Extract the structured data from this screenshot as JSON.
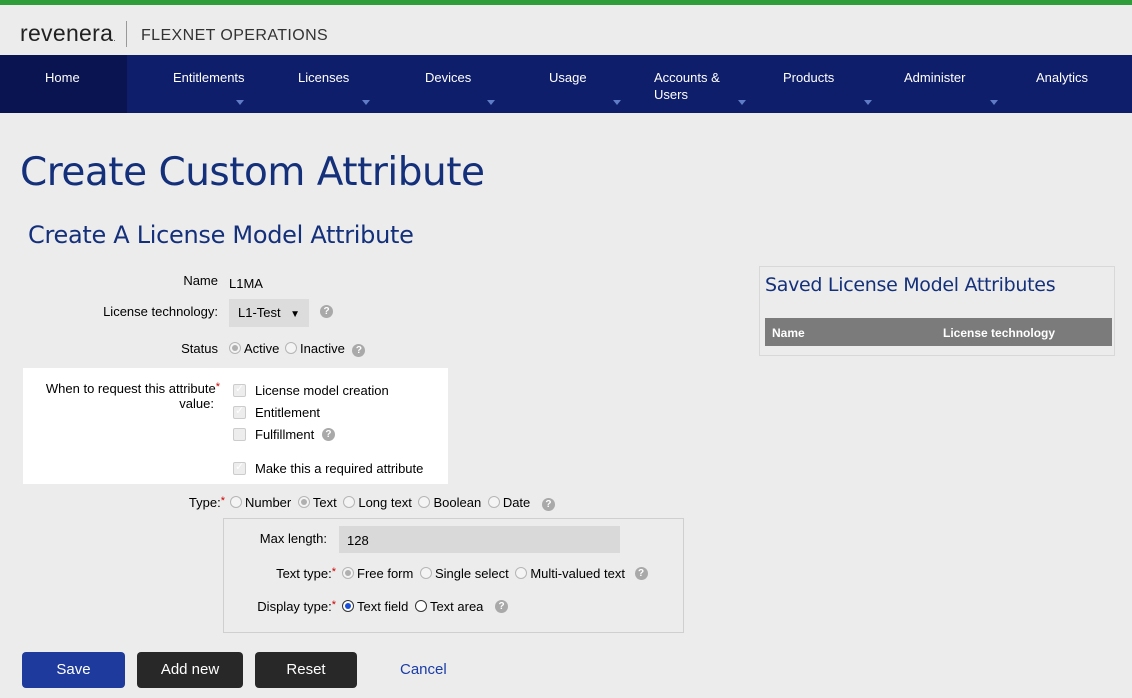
{
  "header": {
    "logo_text": "revenera",
    "logo_tm": ".",
    "product_name": "FLEXNET OPERATIONS"
  },
  "nav": {
    "items": [
      {
        "label": "Home",
        "has_dropdown": false,
        "active": true
      },
      {
        "label": "Entitlements",
        "has_dropdown": true
      },
      {
        "label": "Licenses",
        "has_dropdown": true
      },
      {
        "label": "Devices",
        "has_dropdown": true
      },
      {
        "label": "Usage",
        "has_dropdown": true
      },
      {
        "label_line1": "Accounts &",
        "label_line2": "Users",
        "has_dropdown": true
      },
      {
        "label": "Products",
        "has_dropdown": true
      },
      {
        "label": "Administer",
        "has_dropdown": true
      },
      {
        "label": "Analytics",
        "has_dropdown": false
      }
    ]
  },
  "page": {
    "title": "Create Custom Attribute",
    "subtitle": "Create A License Model Attribute"
  },
  "form": {
    "name_label": "Name",
    "name_value": "L1MA",
    "tech_label": "License technology:",
    "tech_value": "L1-Test",
    "status_label": "Status",
    "status_options": [
      "Active",
      "Inactive"
    ],
    "status_selected": "Active",
    "when_label_line1": "When to request this attribute",
    "when_label_line2": "value:",
    "when_options": [
      {
        "label": "License model creation",
        "checked": true
      },
      {
        "label": "Entitlement",
        "checked": true
      },
      {
        "label": "Fulfillment",
        "checked": false
      }
    ],
    "required_label": "Make this a required attribute",
    "required_checked": true,
    "type_label": "Type:",
    "type_options": [
      "Number",
      "Text",
      "Long text",
      "Boolean",
      "Date"
    ],
    "type_selected": "Text",
    "max_length_label": "Max length:",
    "max_length_value": "128",
    "text_type_label": "Text type:",
    "text_type_options": [
      "Free form",
      "Single select",
      "Multi-valued text"
    ],
    "text_type_selected": "Free form",
    "display_type_label": "Display type:",
    "display_type_options": [
      "Text field",
      "Text area"
    ],
    "display_type_selected": "Text field",
    "required_marker": "*",
    "help_glyph": "?"
  },
  "saved_panel": {
    "title": "Saved License Model Attributes",
    "columns": [
      "Name",
      "License technology"
    ]
  },
  "buttons": {
    "save": "Save",
    "add_new": "Add new",
    "reset": "Reset",
    "cancel": "Cancel"
  },
  "colors": {
    "nav_bg": "#0f1e6a",
    "heading": "#14307a",
    "save_button": "#1d3a9c",
    "top_accent": "#2f9e3a"
  }
}
